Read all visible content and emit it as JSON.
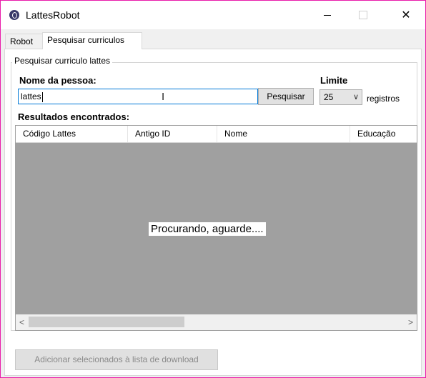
{
  "window": {
    "title": "LattesRobot",
    "minimize_icon": "minimize-icon",
    "maximize_icon": "maximize-icon",
    "close_icon": "close-icon",
    "close_glyph": "✕",
    "border_color": "#e81caa"
  },
  "tabs": [
    {
      "label": "Robot",
      "active": false
    },
    {
      "label": "Pesquisar curriculos",
      "active": true
    }
  ],
  "search_group": {
    "title": "Pesquisar curriculo lattes",
    "name_label": "Nome da pessoa:",
    "name_value": "lattes",
    "search_button": "Pesquisar",
    "limit_label": "Limite",
    "limit_value": "25",
    "limit_suffix": "registros",
    "results_label": "Resultados encontrados:"
  },
  "results_grid": {
    "columns": [
      "Código Lattes",
      "Antigo ID",
      "Nome",
      "Educação"
    ],
    "rows": [],
    "loading_text": "Procurando, aguarde....",
    "scroll_left_glyph": "<",
    "scroll_right_glyph": ">"
  },
  "footer": {
    "add_button": "Adicionar selecionados à lista de download",
    "add_button_enabled": false
  },
  "icons": {
    "app": "app-icon",
    "text_cursor": "text-cursor-icon",
    "dropdown": "chevron-down-icon"
  }
}
